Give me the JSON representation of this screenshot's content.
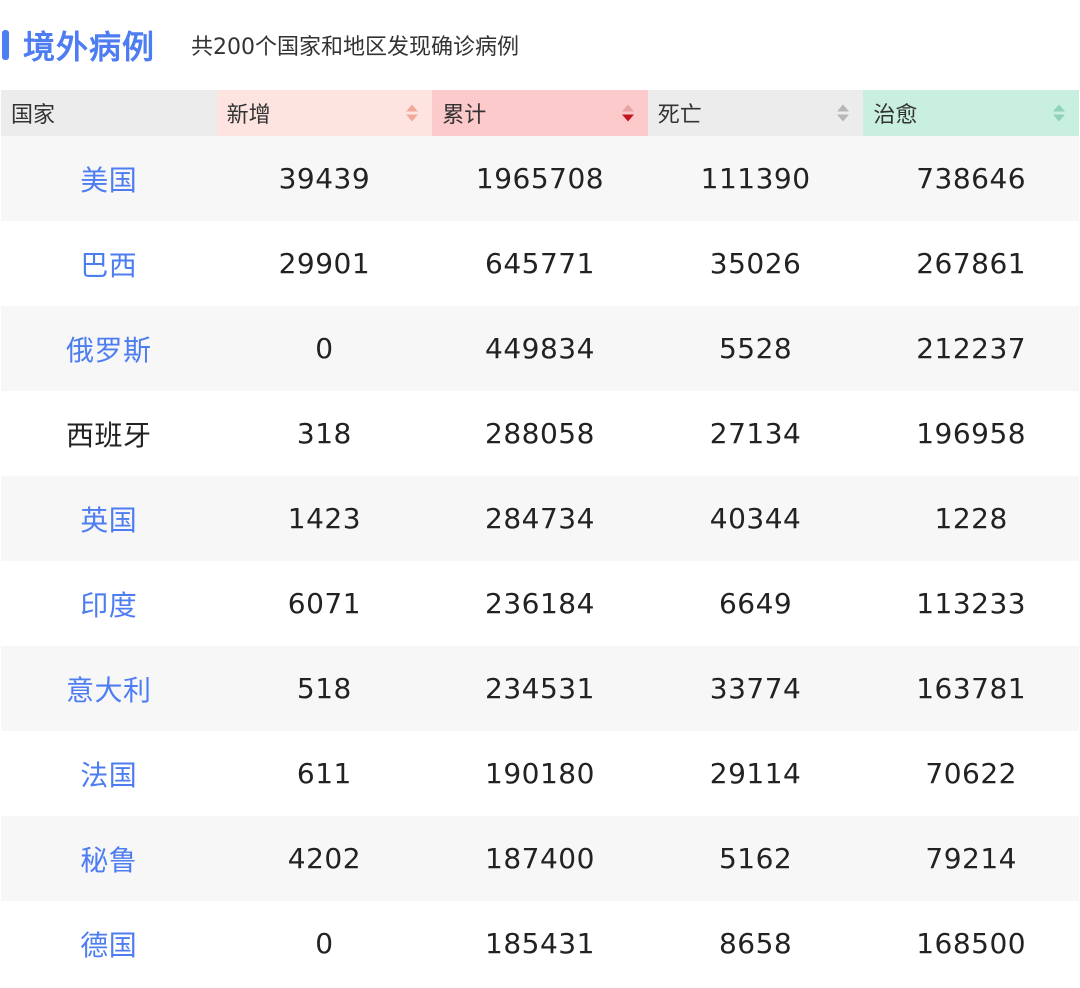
{
  "header": {
    "title": "境外病例",
    "subtitle": "共200个国家和地区发现确诊病例"
  },
  "table": {
    "columns": [
      {
        "label": "国家",
        "sortable": false
      },
      {
        "label": "新增",
        "sortable": true,
        "sort_state": "none"
      },
      {
        "label": "累计",
        "sortable": true,
        "sort_state": "desc"
      },
      {
        "label": "死亡",
        "sortable": true,
        "sort_state": "none"
      },
      {
        "label": "治愈",
        "sortable": true,
        "sort_state": "none"
      }
    ],
    "rows": [
      {
        "country": "美国",
        "link": true,
        "new": "39439",
        "total": "1965708",
        "dead": "111390",
        "cured": "738646"
      },
      {
        "country": "巴西",
        "link": true,
        "new": "29901",
        "total": "645771",
        "dead": "35026",
        "cured": "267861"
      },
      {
        "country": "俄罗斯",
        "link": true,
        "new": "0",
        "total": "449834",
        "dead": "5528",
        "cured": "212237"
      },
      {
        "country": "西班牙",
        "link": false,
        "new": "318",
        "total": "288058",
        "dead": "27134",
        "cured": "196958"
      },
      {
        "country": "英国",
        "link": true,
        "new": "1423",
        "total": "284734",
        "dead": "40344",
        "cured": "1228"
      },
      {
        "country": "印度",
        "link": true,
        "new": "6071",
        "total": "236184",
        "dead": "6649",
        "cured": "113233"
      },
      {
        "country": "意大利",
        "link": true,
        "new": "518",
        "total": "234531",
        "dead": "33774",
        "cured": "163781"
      },
      {
        "country": "法国",
        "link": true,
        "new": "611",
        "total": "190180",
        "dead": "29114",
        "cured": "70622"
      },
      {
        "country": "秘鲁",
        "link": true,
        "new": "4202",
        "total": "187400",
        "dead": "5162",
        "cured": "79214"
      },
      {
        "country": "德国",
        "link": true,
        "new": "0",
        "total": "185431",
        "dead": "8658",
        "cured": "168500"
      }
    ]
  },
  "colors": {
    "accent": "#4e7df2",
    "header_new_bg": "#fde4e0",
    "header_total_bg": "#fdcacb",
    "header_cured_bg": "#c8efdf",
    "sort_new": "#f2a99c",
    "sort_total_active": "#c0181e",
    "sort_total_inactive": "#e8a3a4",
    "sort_dead": "#b7b7b7",
    "sort_cured": "#8fd3b8"
  }
}
